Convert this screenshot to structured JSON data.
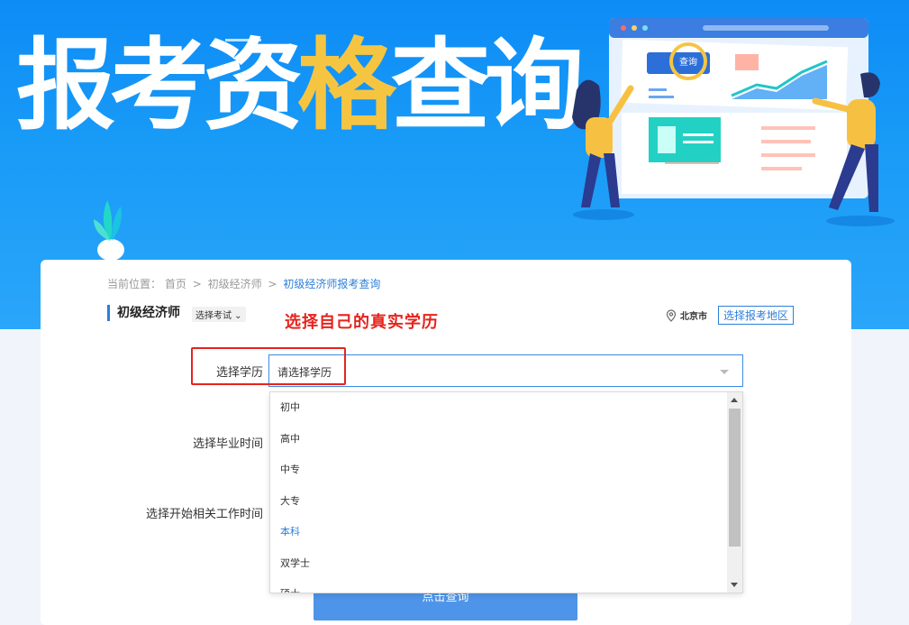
{
  "banner": {
    "title_part1": "报考资",
    "title_accent": "格",
    "title_part2": "查询",
    "illustration_button": "查询"
  },
  "breadcrumb": {
    "prefix": "当前位置：",
    "items": [
      "首页",
      "初级经济师",
      "初级经济师报考查询"
    ],
    "separator": ">"
  },
  "section": {
    "title": "初级经济师",
    "exam_tag": "选择考试"
  },
  "annotation": "选择自己的真实学历",
  "region": {
    "city": "北京市",
    "select_button": "选择报考地区"
  },
  "form": {
    "education_label": "选择学历",
    "education_placeholder": "请选择学历",
    "graduation_label": "选择毕业时间",
    "work_start_label": "选择开始相关工作时间",
    "submit_label": "点击查询"
  },
  "dropdown": {
    "options": [
      "初中",
      "高中",
      "中专",
      "大专",
      "本科",
      "双学士",
      "硕士"
    ],
    "highlighted": "本科"
  },
  "colors": {
    "accent": "#2d7fd9",
    "annotation_red": "#e5241d",
    "banner_blue": "#199bf7",
    "title_accent": "#f5c542"
  }
}
